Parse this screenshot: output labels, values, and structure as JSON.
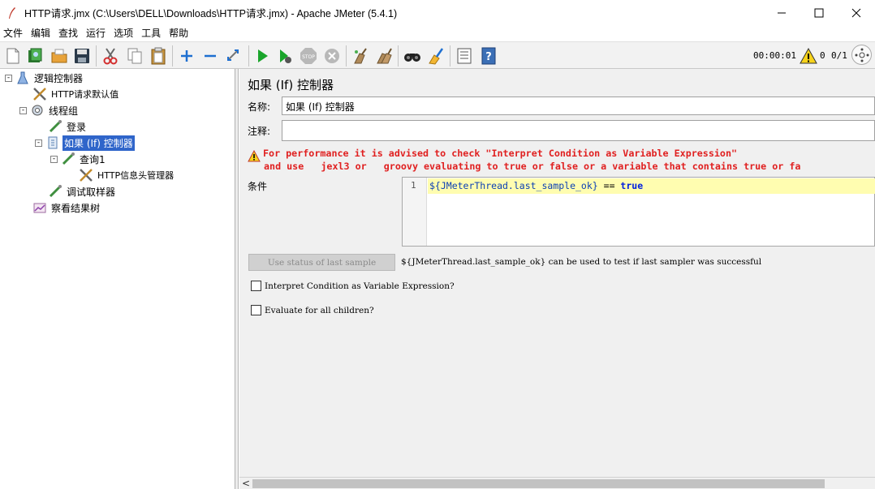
{
  "window": {
    "title": "HTTP请求.jmx (C:\\Users\\DELL\\Downloads\\HTTP请求.jmx) - Apache JMeter (5.4.1)",
    "minimize": "—",
    "maximize": "☐",
    "close": "✕"
  },
  "menu": [
    "文件",
    "编辑",
    "查找",
    "运行",
    "选项",
    "工具",
    "帮助"
  ],
  "toolbar": {
    "timer": "00:00:01",
    "warnings": "0",
    "threads": "0/1",
    "icons": [
      "new-icon",
      "templates-icon",
      "open-icon",
      "save-icon",
      "cut-icon",
      "copy-icon",
      "paste-icon",
      "expand-icon",
      "collapse-icon",
      "toggle-icon",
      "start-icon",
      "start-no-pause-icon",
      "stop-icon",
      "shutdown-icon",
      "clear-icon",
      "clear-all-icon",
      "search-icon",
      "reset-search-icon",
      "function-helper-icon",
      "help-icon",
      "warning-icon",
      "remote-icon"
    ]
  },
  "tree": {
    "items": [
      {
        "label": "逻辑控制器",
        "icon": "test-plan-icon",
        "expander": "-"
      },
      {
        "label": "HTTP请求默认值",
        "icon": "config-tool-icon"
      },
      {
        "label": "线程组",
        "icon": "thread-group-icon",
        "expander": "-"
      },
      {
        "label": "登录",
        "icon": "sampler-icon"
      },
      {
        "label": "如果 (If) 控制器",
        "icon": "controller-icon",
        "expander": "-",
        "selected": true
      },
      {
        "label": "查询1",
        "icon": "sampler-icon",
        "expander": "-"
      },
      {
        "label": "HTTP信息头管理器",
        "icon": "config-tool-icon"
      },
      {
        "label": "调试取样器",
        "icon": "sampler-icon"
      },
      {
        "label": "察看结果树",
        "icon": "listener-icon"
      }
    ]
  },
  "panel": {
    "title": "如果 (If) 控制器",
    "name_label": "名称:",
    "name_value": "如果 (If) 控制器",
    "comment_label": "注释:",
    "comment_value": "",
    "warning_line1": "For performance it is advised to check \"Interpret Condition as Variable Expression\"",
    "warning_line2": "and use   jexl3 or   groovy evaluating to true or false or a variable that contains true or fa",
    "condition_label": "条件",
    "line_number": "1",
    "code_var": "${JMeterThread.last_sample_ok}",
    "code_op": " == ",
    "code_kw": "true",
    "use_status_button": "Use status of last sample",
    "hint": "${JMeterThread.last_sample_ok} can be used to test if last sampler was successful",
    "checkbox1": "Interpret Condition as Variable Expression?",
    "checkbox2": "Evaluate for all children?",
    "checkbox1_checked": false,
    "checkbox2_checked": false,
    "scroll_left_arrow": "<"
  }
}
